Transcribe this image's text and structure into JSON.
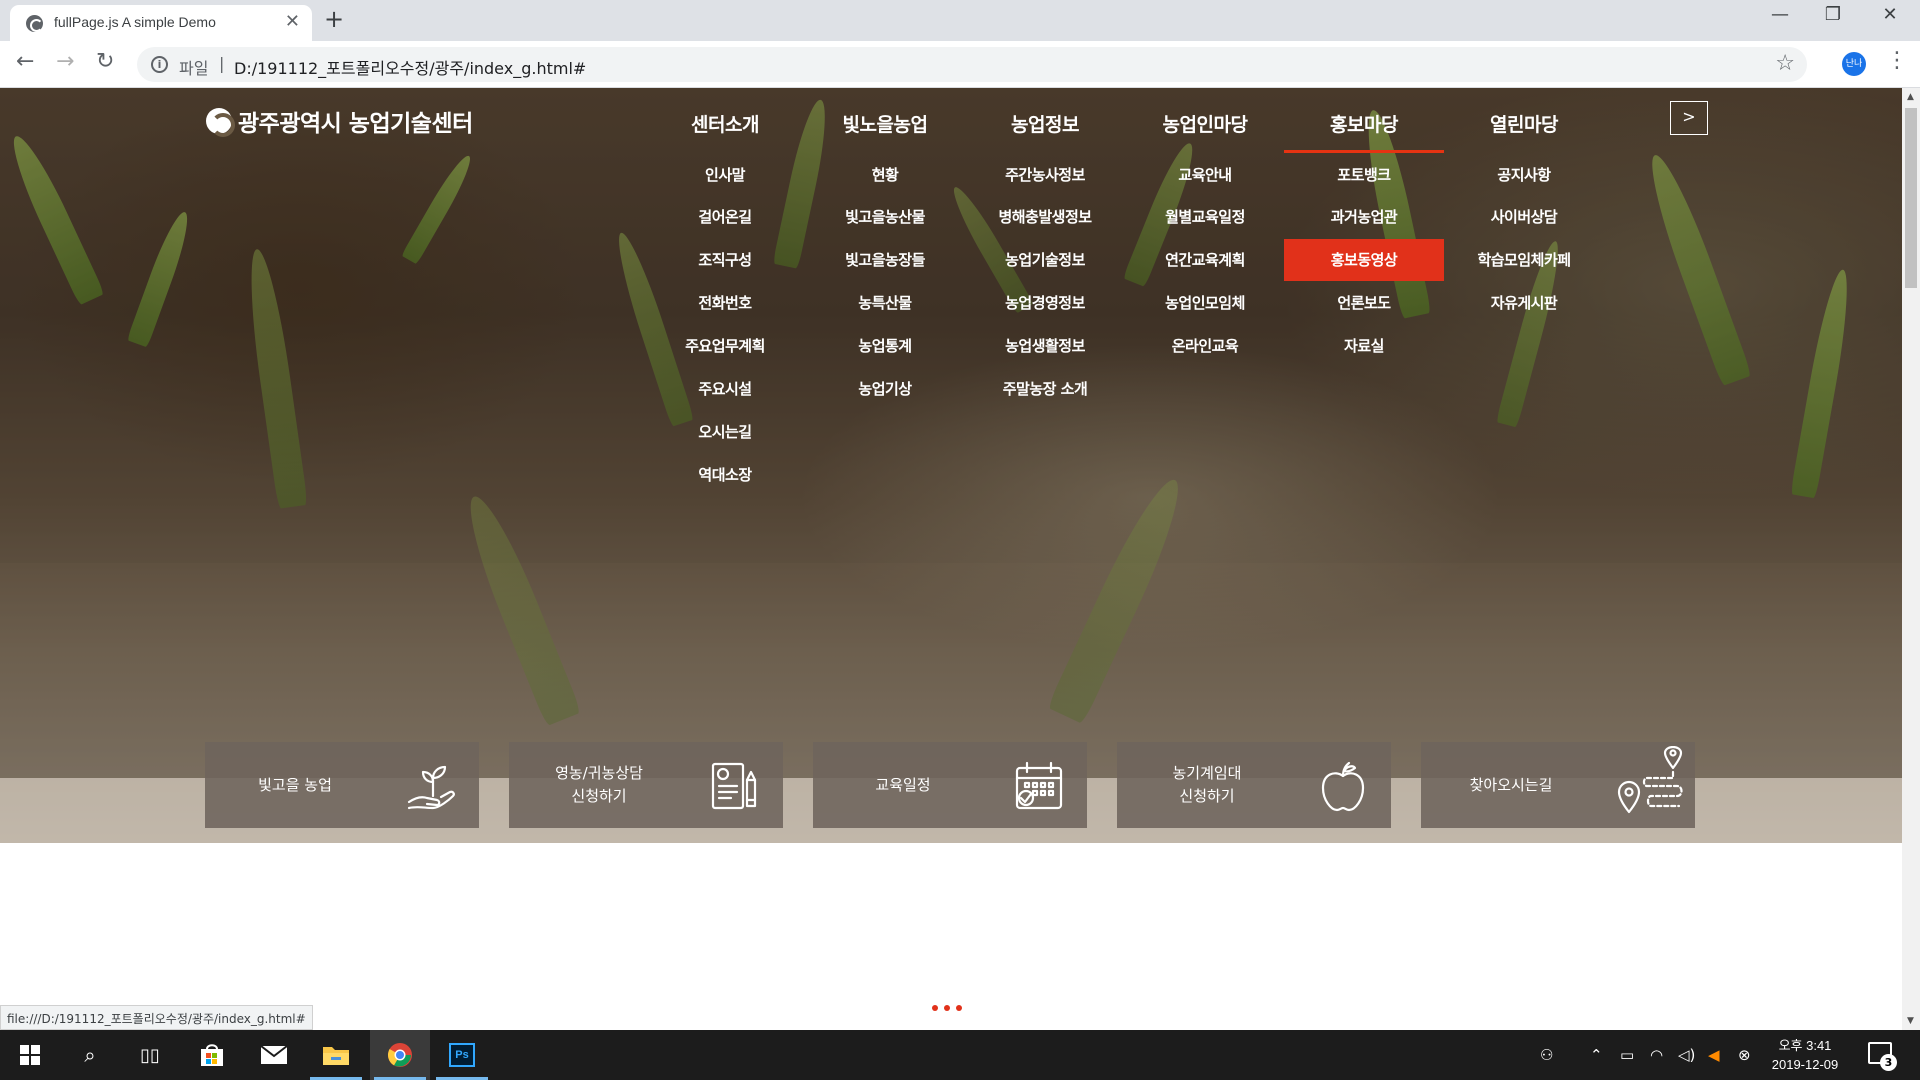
{
  "browser": {
    "tab_title": "fullPage.js A simple Demo",
    "omnibox_scheme": "파일",
    "omnibox_url": "D:/191112_포트폴리오수정/광주/index_g.html#",
    "profile_initials": "난나"
  },
  "site": {
    "logo_text": "광주광역시 농업기술센터",
    "accent_color": "#e1311a",
    "gnb": [
      {
        "title": "센터소개",
        "items": [
          "인사말",
          "걸어온길",
          "조직구성",
          "전화번호",
          "주요업무계획",
          "주요시설",
          "오시는길",
          "역대소장"
        ]
      },
      {
        "title": "빛노을농업",
        "items": [
          "현황",
          "빛고을농산물",
          "빛고을농장들",
          "농특산물",
          "농업통계",
          "농업기상"
        ]
      },
      {
        "title": "농업정보",
        "items": [
          "주간농사정보",
          "병해충발생정보",
          "농업기술정보",
          "농업경영정보",
          "농업생활정보",
          "주말농장 소개"
        ]
      },
      {
        "title": "농업인마당",
        "items": [
          "교육안내",
          "월별교육일정",
          "연간교육계획",
          "농업인모임체",
          "온라인교육"
        ]
      },
      {
        "title": "홍보마당",
        "items": [
          "포토뱅크",
          "과거농업관",
          "홍보동영상",
          "언론보도",
          "자료실"
        ],
        "active_index": 2
      },
      {
        "title": "열린마당",
        "items": [
          "공지사항",
          "사이버상담",
          "학습모임체카페",
          "자유게시판"
        ]
      }
    ],
    "next_button": ">",
    "quick_menu": [
      {
        "label": "빛고을 농업",
        "icon": "hand-plant-icon"
      },
      {
        "label": "영농/귀농상담\n신청하기",
        "icon": "document-pen-icon"
      },
      {
        "label": "교육일정",
        "icon": "calendar-check-icon"
      },
      {
        "label": "농기계임대\n신청하기",
        "icon": "apple-icon"
      },
      {
        "label": "찾아오시는길",
        "icon": "map-route-icon"
      }
    ]
  },
  "status_bar_url": "file:///D:/191112_포트폴리오수정/광주/index_g.html#",
  "taskbar": {
    "clock_period_time": "오후 3:41",
    "clock_date": "2019-12-09",
    "notification_count": "3"
  }
}
